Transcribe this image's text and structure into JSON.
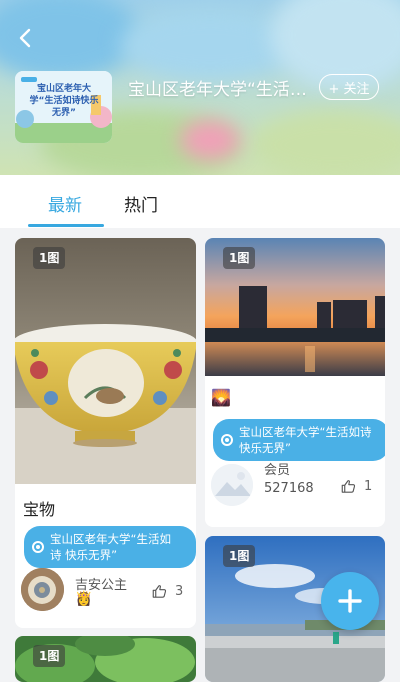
{
  "header": {
    "title": "宝山区老年大学“生活如诗 快乐无界”",
    "follow_label": "+ 关注",
    "cover_text": "宝山区老年大学“生活如诗快乐无界”"
  },
  "tabs": [
    {
      "label": "最新",
      "active": true
    },
    {
      "label": "热门",
      "active": false
    }
  ],
  "posts": [
    {
      "badge": "1图",
      "title": "宝物",
      "topic": "宝山区老年大学“生活如诗 快乐无界”",
      "author": "吉安公主",
      "author_emoji": "👸",
      "likes": "3"
    },
    {
      "badge": "1图",
      "emoji": "🌄",
      "topic": "宝山区老年大学“生活如诗 快乐无界”",
      "author": "会员527168",
      "likes": "1"
    },
    {
      "badge": "1图"
    },
    {
      "badge": "1图"
    }
  ],
  "colors": {
    "accent": "#38a8e0",
    "topic_bg": "#4ab0e6",
    "fab": "#48b4ec"
  }
}
